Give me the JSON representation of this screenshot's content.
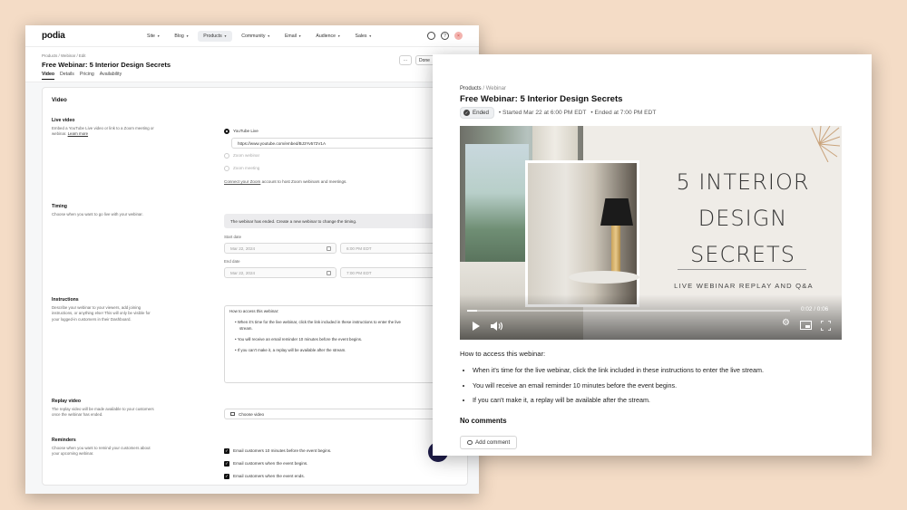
{
  "editor": {
    "logo": "podia",
    "nav": [
      {
        "label": "Site"
      },
      {
        "label": "Blog"
      },
      {
        "label": "Products"
      },
      {
        "label": "Community"
      },
      {
        "label": "Email"
      },
      {
        "label": "Audience"
      },
      {
        "label": "Sales"
      }
    ],
    "breadcrumb": "Products / Webinar / Edit",
    "title": "Free Webinar: 5 Interior Design Secrets",
    "tabs": [
      "Video",
      "Details",
      "Pricing",
      "Availability"
    ],
    "more_label": "···",
    "done_label": "Done",
    "section_title": "Video",
    "live_video": {
      "label": "Live video",
      "desc_line1": "Embed a YouTube Live video or link to a Zoom meeting or",
      "desc_line2": "webinar.",
      "learn_more": "Learn more",
      "options": [
        "YouTube Live",
        "Zoom webinar",
        "Zoom meeting"
      ],
      "url_value": "https://www.youtube.com/embed/BJ3Yv572V1A",
      "connect_link": "Connect your Zoom",
      "connect_rest": " account to host Zoom webinars and meetings."
    },
    "timing": {
      "label": "Timing",
      "desc": "Choose when you want to go live with your webinar.",
      "notice": "The webinar has ended. Create a new webinar to change the timing.",
      "start_label": "Start date",
      "start_date": "Mar 22, 2024",
      "start_time": "6:00 PM EDT",
      "end_label": "End date",
      "end_date": "Mar 22, 2024",
      "end_time": "7:00 PM EDT"
    },
    "instructions": {
      "label": "Instructions",
      "desc_line1": "Describe your webinar to your viewers, add joining",
      "desc_line2": "instructions, or anything else! This will only be visible for",
      "desc_line3": "your logged-in customers in their Dashboard.",
      "heading": "How to access this webinar:",
      "b1_line1": "When it's time for the live webinar, click the link included in these instructions to enter the live",
      "b1_line2": "stream.",
      "b2": "You will receive an email reminder 10 minutes before the event begins.",
      "b3": "If you can't make it, a replay will be available after the stream."
    },
    "replay": {
      "label": "Replay video",
      "desc_line1": "The replay video will be made available to your customers",
      "desc_line2": "once the webinar has ended.",
      "button": "Choose video"
    },
    "reminders": {
      "label": "Reminders",
      "desc_line1": "Choose when you want to remind your customers about",
      "desc_line2": "your upcoming webinar.",
      "items": [
        "Email customers 10 minutes before the event begins.",
        "Email customers when the event begins.",
        "Email customers when the event ends."
      ]
    },
    "help": "?"
  },
  "preview": {
    "breadcrumb_root": "Products",
    "breadcrumb_sep": " / ",
    "breadcrumb_leaf": "Webinar",
    "title": "Free Webinar: 5 Interior Design Secrets",
    "status": "Ended",
    "started": "• Started Mar 22 at 6:00 PM EDT",
    "ended": "• Ended at 7:00 PM EDT",
    "video": {
      "heading": "5 INTERIOR DESIGN SECRETS",
      "subheading": "LIVE WEBINAR REPLAY AND Q&A",
      "time": "0:02 / 0:06",
      "progress": 0.03
    },
    "how_heading": "How to access this webinar:",
    "bullets": [
      "When it's time for the live webinar, click the link included in these instructions to enter the live stream.",
      "You will receive an email reminder 10 minutes before the event begins.",
      "If you can't make it, a replay will be available after the stream."
    ],
    "no_comments": "No comments",
    "add_comment": "Add comment"
  }
}
